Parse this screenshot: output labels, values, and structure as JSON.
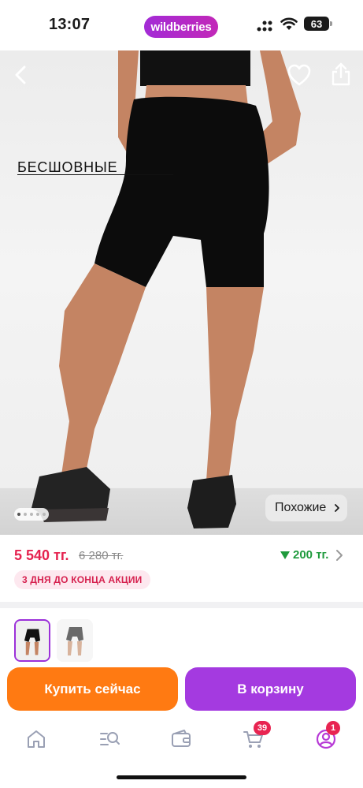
{
  "status_bar": {
    "time": "13:07",
    "brand": "wildberries",
    "battery": "63",
    "signal_icon": "signal-icon",
    "wifi_icon": "wifi-icon"
  },
  "product": {
    "overlay_text": "БЕСШОВНЫЕ",
    "similar_label": "Похожие",
    "gallery": {
      "total_images": 5,
      "active_index": 0
    }
  },
  "price": {
    "current": "5 540 тг.",
    "old": "6 280 тг.",
    "discount": "200 тг.",
    "promo": "3 ДНЯ ДО КОНЦА АКЦИИ"
  },
  "colors": {
    "accent": "#a43ae0",
    "buy": "#ff7a12",
    "price": "#e5224f",
    "discount": "#1e9a3c"
  },
  "actions": {
    "buy_label": "Купить сейчас",
    "cart_label": "В корзину"
  },
  "nav": {
    "items": [
      {
        "name": "home",
        "icon": "home-icon"
      },
      {
        "name": "catalog",
        "icon": "catalog-search-icon"
      },
      {
        "name": "wallet",
        "icon": "wallet-icon"
      },
      {
        "name": "cart",
        "icon": "cart-icon",
        "badge": "39"
      },
      {
        "name": "profile",
        "icon": "profile-icon",
        "badge": "1"
      }
    ]
  }
}
